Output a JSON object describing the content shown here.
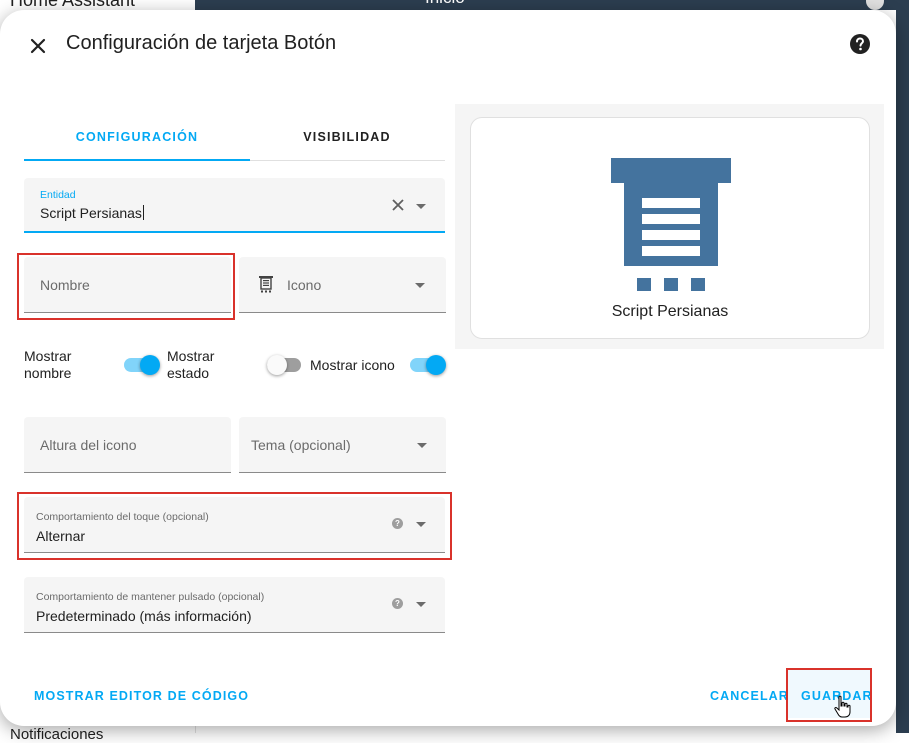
{
  "background": {
    "sidebar_title": "Home Assistant",
    "header_text": "Inicio",
    "sidebar_bottom": "Notificaciones"
  },
  "dialog": {
    "title": "Configuración de tarjeta Botón",
    "close_icon": "close-icon",
    "help_icon": "help-circle-icon"
  },
  "tabs": [
    {
      "label": "CONFIGURACIÓN",
      "active": true
    },
    {
      "label": "VISIBILIDAD",
      "active": false
    }
  ],
  "form": {
    "entity": {
      "label": "Entidad",
      "value": "Script Persianas"
    },
    "name": {
      "placeholder": "Nombre"
    },
    "icon": {
      "placeholder": "Icono",
      "icon": "window-shutter-icon"
    },
    "toggles": [
      {
        "label_line1": "Mostrar",
        "label_line2": "nombre",
        "on": true
      },
      {
        "label_line1": "Mostrar",
        "label_line2": "estado",
        "on": false
      },
      {
        "label_line1": "Mostrar icono",
        "label_line2": "",
        "on": true
      }
    ],
    "icon_height": {
      "placeholder": "Altura del icono"
    },
    "theme": {
      "placeholder": "Tema (opcional)"
    },
    "tap_action": {
      "label": "Comportamiento del toque (opcional)",
      "value": "Alternar"
    },
    "hold_action": {
      "label": "Comportamiento de mantener pulsado (opcional)",
      "value": "Predeterminado (más información)"
    }
  },
  "preview": {
    "entity_name": "Script Persianas",
    "icon": "window-shutter-icon",
    "icon_color": "#44739e"
  },
  "footer": {
    "code_editor": "MOSTRAR EDITOR DE CÓDIGO",
    "cancel": "CANCELAR",
    "save": "GUARDAR"
  },
  "colors": {
    "accent": "#03a9f4",
    "highlight_box": "#d9322b",
    "header_bg": "#2c3e50"
  }
}
